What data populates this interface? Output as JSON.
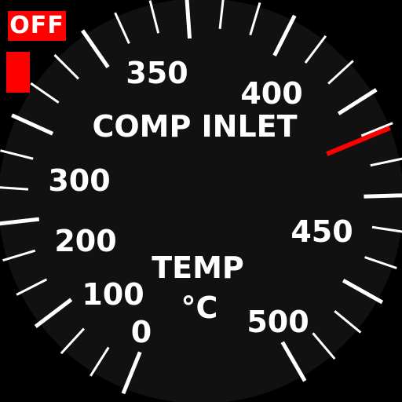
{
  "flag": {
    "text": "OFF"
  },
  "gauge": {
    "title": "COMP INLET",
    "subtitle": "TEMP",
    "unit": "°C",
    "scale_labels": [
      "0",
      "100",
      "200",
      "300",
      "350",
      "400",
      "450",
      "500"
    ],
    "redline_value": 410,
    "colors": {
      "face": "#111111",
      "ticks": "#ffffff",
      "redline": "#ff0000",
      "flag": "#ff0000"
    }
  }
}
